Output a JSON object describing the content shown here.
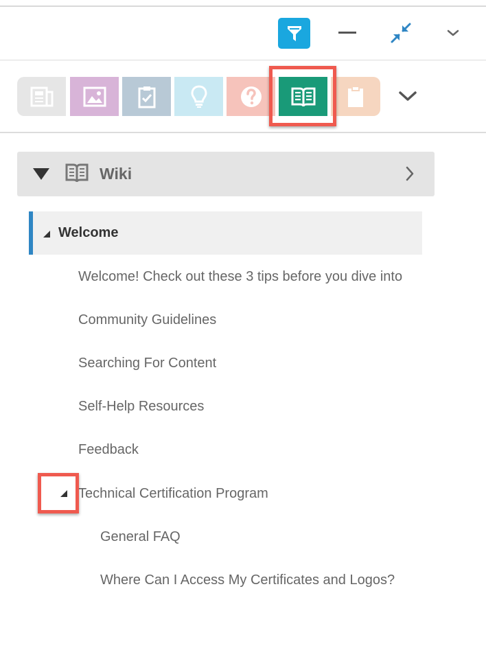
{
  "toolbar": {
    "filter_icon": "filter-funnel-icon",
    "minimize_icon": "minimize-dash-icon",
    "collapse_icon": "collapse-arrows-icon",
    "menu_icon": "chevron-down-icon",
    "accent_color": "#1aa7df"
  },
  "content_types": [
    {
      "icon": "news-icon",
      "color": "#e6e6e6"
    },
    {
      "icon": "image-icon",
      "color": "#d8b4d8"
    },
    {
      "icon": "clipboard-check-icon",
      "color": "#b8c9d6"
    },
    {
      "icon": "lightbulb-icon",
      "color": "#c9e9f3"
    },
    {
      "icon": "question-icon",
      "color": "#f6c3bb"
    },
    {
      "icon": "book-icon",
      "color": "#199a78",
      "selected": true
    },
    {
      "icon": "clipboard-icon",
      "color": "#f6d6c0"
    }
  ],
  "wiki": {
    "title": "Wiki",
    "toggle_icon": "triangle-down-icon",
    "next_icon": "chevron-right-icon"
  },
  "tree": {
    "section": {
      "label": "Welcome",
      "accent_color": "#2f86c4"
    },
    "items": [
      "Welcome! Check out these 3 tips before you dive into",
      "Community Guidelines",
      "Searching For Content",
      "Self-Help Resources",
      "Feedback"
    ],
    "subsection": {
      "label": "Technical Certification Program",
      "items": [
        "General FAQ",
        "Where Can I Access My Certificates and Logos?"
      ]
    }
  },
  "highlight_color": "#ef5a4f"
}
